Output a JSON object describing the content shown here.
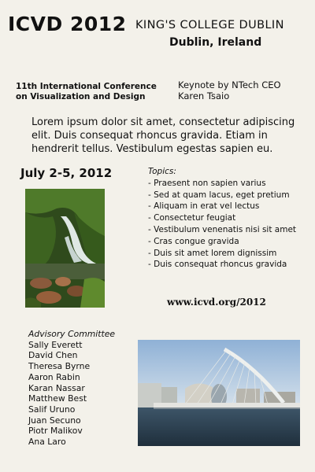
{
  "header": {
    "title": "ICVD 2012",
    "venue": "KING'S COLLEGE DUBLIN",
    "city": "Dublin, Ireland"
  },
  "conference": {
    "name_line1": "11th International Conference",
    "name_line2": "on Visualization and Design"
  },
  "keynote": {
    "line1": "Keynote by NTech CEO",
    "line2": "Karen Tsaio"
  },
  "intro": "Lorem ipsum dolor sit amet, consectetur adipiscing elit. Duis consequat rhoncus gravida. Etiam in hendrerit tellus. Vestibulum egestas sapien eu.",
  "dates": "July 2-5, 2012",
  "topics": {
    "heading": "Topics:",
    "items": [
      "Praesent non sapien varius",
      "Sed at quam lacus, eget pretium",
      "Aliquam in erat vel lectus",
      "Consectetur feugiat",
      "Vestibulum venenatis nisi sit amet",
      "Cras congue gravida",
      "Duis sit amet lorem dignissim",
      "Duis consequat rhoncus gravida"
    ]
  },
  "website": "www.icvd.org/2012",
  "committee": {
    "heading": "Advisory Committee",
    "members": [
      "Sally Everett",
      "David Chen",
      "Theresa Byrne",
      "Aaron Rabin",
      "Karan Nassar",
      "Matthew Best",
      "Salif Uruno",
      "Juan Secuno",
      "Piotr Malikov",
      "Ana Laro"
    ]
  },
  "images": {
    "waterfall": "waterfall-photo",
    "bridge": "harp-bridge-photo"
  }
}
